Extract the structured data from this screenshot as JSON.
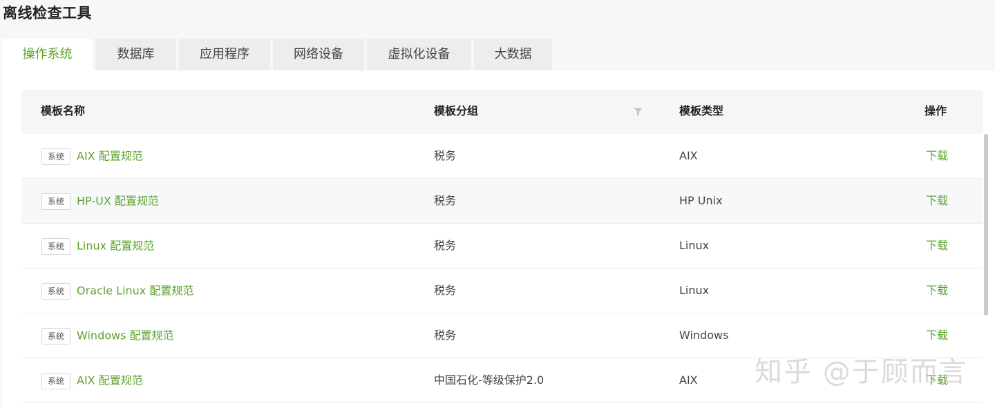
{
  "page": {
    "title": "离线检查工具"
  },
  "tabs": [
    {
      "label": "操作系统",
      "active": true
    },
    {
      "label": "数据库",
      "active": false
    },
    {
      "label": "应用程序",
      "active": false
    },
    {
      "label": "网络设备",
      "active": false
    },
    {
      "label": "虚拟化设备",
      "active": false
    },
    {
      "label": "大数据",
      "active": false
    }
  ],
  "table": {
    "columns": {
      "name": "模板名称",
      "group": "模板分组",
      "type": "模板类型",
      "action": "操作"
    },
    "filter_icon": "filter-icon",
    "rows": [
      {
        "tag": "系统",
        "name": "AIX 配置规范",
        "group": "税务",
        "type": "AIX",
        "action": "下载"
      },
      {
        "tag": "系统",
        "name": "HP-UX 配置规范",
        "group": "税务",
        "type": "HP Unix",
        "action": "下载"
      },
      {
        "tag": "系统",
        "name": "Linux 配置规范",
        "group": "税务",
        "type": "Linux",
        "action": "下载"
      },
      {
        "tag": "系统",
        "name": "Oracle Linux 配置规范",
        "group": "税务",
        "type": "Linux",
        "action": "下载"
      },
      {
        "tag": "系统",
        "name": "Windows 配置规范",
        "group": "税务",
        "type": "Windows",
        "action": "下载"
      },
      {
        "tag": "系统",
        "name": "AIX 配置规范",
        "group": "中国石化-等级保护2.0",
        "type": "AIX",
        "action": "下载"
      }
    ]
  },
  "watermark": {
    "text": "知乎 @于顾而言"
  },
  "colors": {
    "accent": "#5ea32e",
    "header_bg": "#f5f6f8",
    "page_bg": "#f6f7f8"
  }
}
